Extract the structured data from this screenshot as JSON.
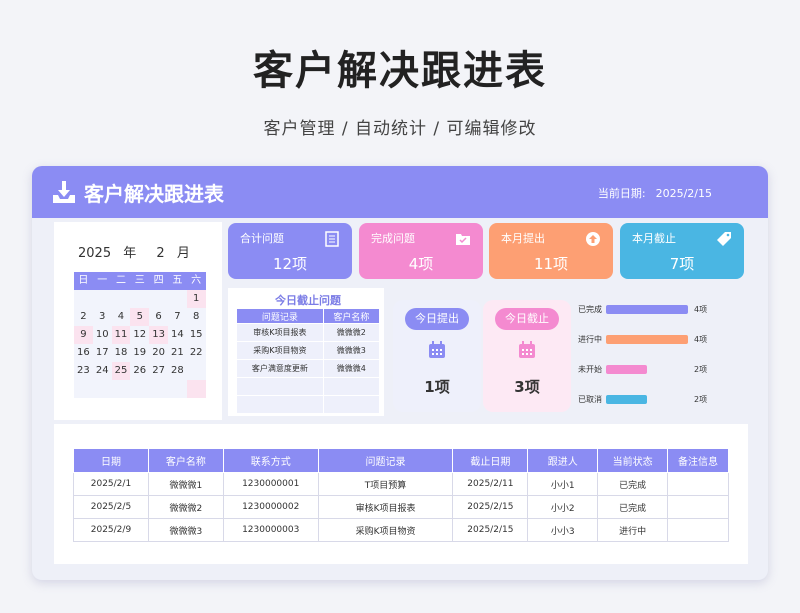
{
  "hero": {
    "title": "客户解决跟进表",
    "subtitle": "客户管理 /  自动统计  /  可编辑修改"
  },
  "header": {
    "title": "客户解决跟进表",
    "date_label": "当前日期:",
    "date_value": "2025/2/15"
  },
  "calendar": {
    "year": "2025",
    "year_unit": "年",
    "month": "2",
    "month_unit": "月",
    "weekdays": [
      "日",
      "一",
      "二",
      "三",
      "四",
      "五",
      "六"
    ],
    "days": [
      "",
      "",
      "",
      "",
      "",
      "",
      "1",
      "2",
      "3",
      "4",
      "5",
      "6",
      "7",
      "8",
      "9",
      "10",
      "11",
      "12",
      "13",
      "14",
      "15",
      "16",
      "17",
      "18",
      "19",
      "20",
      "21",
      "22",
      "23",
      "24",
      "25",
      "26",
      "27",
      "28",
      "",
      "",
      "",
      "",
      "",
      "",
      "",
      ""
    ],
    "highlighted_days": [
      "5",
      "9",
      "11",
      "13",
      "25"
    ]
  },
  "cards": [
    {
      "label": "合计问题",
      "value": "12项",
      "color": "#8b8cf3",
      "icon": "document-icon"
    },
    {
      "label": "完成问题",
      "value": "4项",
      "color": "#f48ad0",
      "icon": "folder-check-icon"
    },
    {
      "label": "本月提出",
      "value": "11项",
      "color": "#fd9f73",
      "icon": "upload-icon"
    },
    {
      "label": "本月截止",
      "value": "7项",
      "color": "#4ab6e3",
      "icon": "tag-icon"
    }
  ],
  "today_deadline": {
    "title": "今日截止问题",
    "headers": [
      "问题记录",
      "客户名称"
    ],
    "rows": [
      [
        "审核K项目报表",
        "微微微2"
      ],
      [
        "采购K项目物资",
        "微微微3"
      ],
      [
        "客户满意度更新",
        "微微微4"
      ],
      [
        "",
        ""
      ],
      [
        "",
        ""
      ]
    ]
  },
  "today_raised": {
    "label": "今日提出",
    "value": "1项",
    "color": "#8b8cf3",
    "bg": "#eef0fb"
  },
  "today_due": {
    "label": "今日截止",
    "value": "3项",
    "color": "#f48ad0",
    "bg": "#fde9f4"
  },
  "status_bars": [
    {
      "label": "已完成",
      "value": 4,
      "text": "4项",
      "color": "#8b8cf3"
    },
    {
      "label": "进行中",
      "value": 4,
      "text": "4项",
      "color": "#fd9f73"
    },
    {
      "label": "未开始",
      "value": 2,
      "text": "2项",
      "color": "#f48ad0"
    },
    {
      "label": "已取消",
      "value": 2,
      "text": "2项",
      "color": "#4ab6e3"
    }
  ],
  "main_table": {
    "headers": [
      "日期",
      "客户名称",
      "联系方式",
      "问题记录",
      "截止日期",
      "跟进人",
      "当前状态",
      "备注信息"
    ],
    "rows": [
      [
        "2025/2/1",
        "微微微1",
        "1230000001",
        "T项目预算",
        "2025/2/11",
        "小小1",
        "已完成",
        ""
      ],
      [
        "2025/2/5",
        "微微微2",
        "1230000002",
        "审核K项目报表",
        "2025/2/15",
        "小小2",
        "已完成",
        ""
      ],
      [
        "2025/2/9",
        "微微微3",
        "1230000003",
        "采购K项目物资",
        "2025/2/15",
        "小小3",
        "进行中",
        ""
      ]
    ]
  }
}
